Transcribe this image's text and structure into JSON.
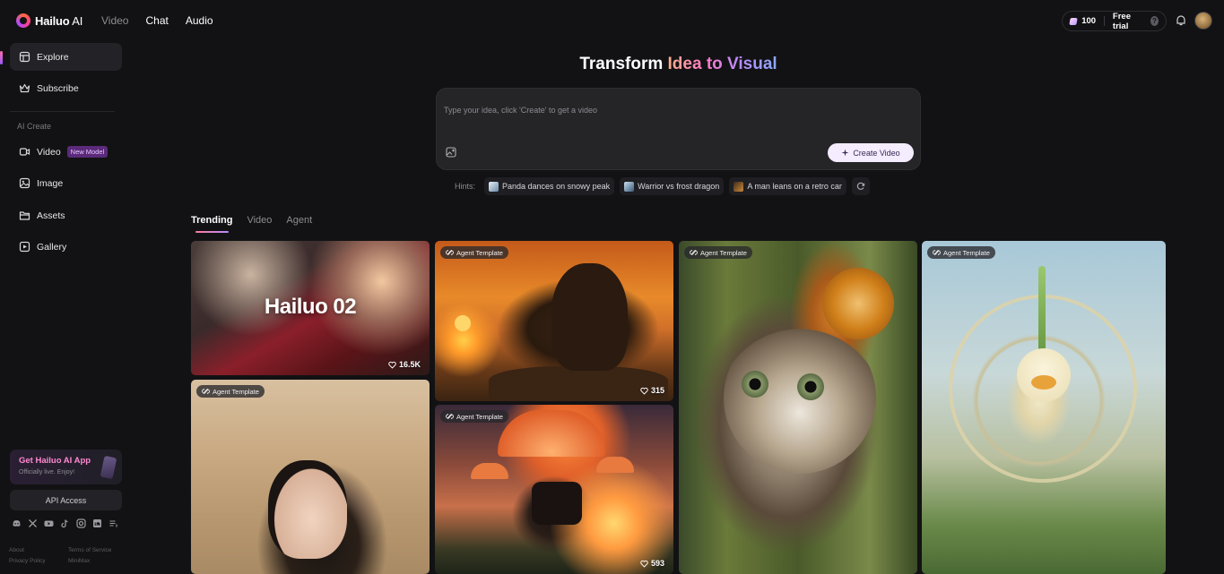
{
  "header": {
    "brand": "Hailuo",
    "brand_suffix": " AI",
    "nav": [
      "Video",
      "Chat",
      "Audio"
    ],
    "credits": "100",
    "free_trial": "Free trial"
  },
  "sidebar": {
    "items": [
      {
        "label": "Explore",
        "icon": "explore-icon"
      },
      {
        "label": "Subscribe",
        "icon": "crown-icon"
      }
    ],
    "section_label": "AI Create",
    "create_items": [
      {
        "label": "Video",
        "badge": "New Model",
        "icon": "video-icon"
      },
      {
        "label": "Image",
        "icon": "image-icon"
      },
      {
        "label": "Assets",
        "icon": "folder-icon"
      },
      {
        "label": "Gallery",
        "icon": "gallery-icon"
      }
    ],
    "promo_title": "Get Hailuo AI App",
    "promo_sub": "Officially live. Enjoy!",
    "api_label": "API Access",
    "footer": [
      "About",
      "Terms of Service",
      "Privacy Policy",
      "MiniMax"
    ]
  },
  "hero": {
    "title_plain": "Transform ",
    "title_gradient": "Idea to Visual",
    "placeholder": "Type your idea, click 'Create' to get a video",
    "create_label": "Create Video"
  },
  "hints": {
    "label": "Hints:",
    "items": [
      "Panda dances on snowy peak",
      "Warrior vs frost dragon",
      "A man leans on a retro car"
    ]
  },
  "tabs": [
    "Trending",
    "Video",
    "Agent"
  ],
  "cards": {
    "c1_caption": "Hailuo 02",
    "c1_likes": "16.5K",
    "tag": "Agent Template",
    "c2_likes": "315",
    "c3_likes": "593"
  },
  "colors": {
    "background": "#121214",
    "accent_pink": "#ff7ac6",
    "accent_purple": "#b48bff"
  }
}
